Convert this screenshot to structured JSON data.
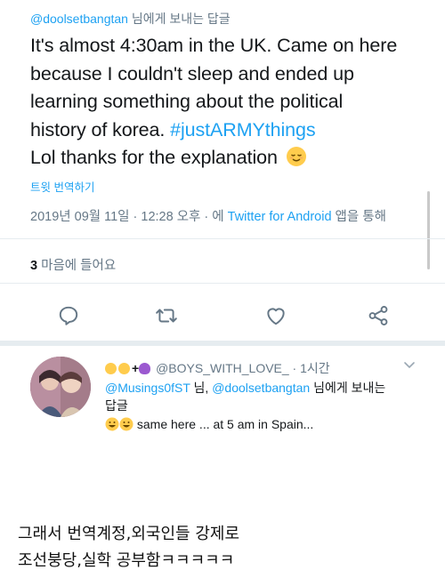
{
  "tweet": {
    "reply_to_handle": "@doolsetbangtan",
    "reply_to_suffix": " 님에게 보내는 답글",
    "lines": [
      "It's almost 4:30am in the UK. Came on here",
      "because I couldn't sleep and ended up",
      "learning something about the political",
      "history of korea. "
    ],
    "hashtag": "#justARMYthings",
    "last_line": "Lol thanks for the explanation ",
    "emoji": "relieved-face-emoji",
    "translate_label": "트윗 번역하기",
    "timestamp": "2019년 09월 11일 · 12:28 오후 · 에 ",
    "source": "Twitter for Android",
    "source_suffix": " 앱을 통해",
    "likes_count": "3",
    "likes_label": " 마음에 들어요"
  },
  "actions": {
    "reply_icon": "reply-icon",
    "retweet_icon": "retweet-icon",
    "like_icon": "heart-icon",
    "share_icon": "share-icon"
  },
  "reply": {
    "name_emoji": "baby-face-emoji baby-face-emoji + purple-heart-emoji",
    "name_plus": "+",
    "handle": "@BOYS_WITH_LOVE_",
    "time": " · 1시간",
    "mention_1": "@Musings0fST",
    "mention_sep": " 님, ",
    "mention_2": "@doolsetbangtan",
    "mention_suffix": " 님에게 보내는",
    "mention_suffix_2": "답글",
    "text": " same here ... at 5 am in Spain..."
  },
  "caption": {
    "line1": "그래서 번역계정,외국인들 강제로",
    "line2": "조선붕당,실학 공부함ㅋㅋㅋㅋㅋ"
  },
  "colors": {
    "accent": "#1da1f2",
    "secondary_text": "#657786",
    "divider": "#e6ecf0"
  }
}
